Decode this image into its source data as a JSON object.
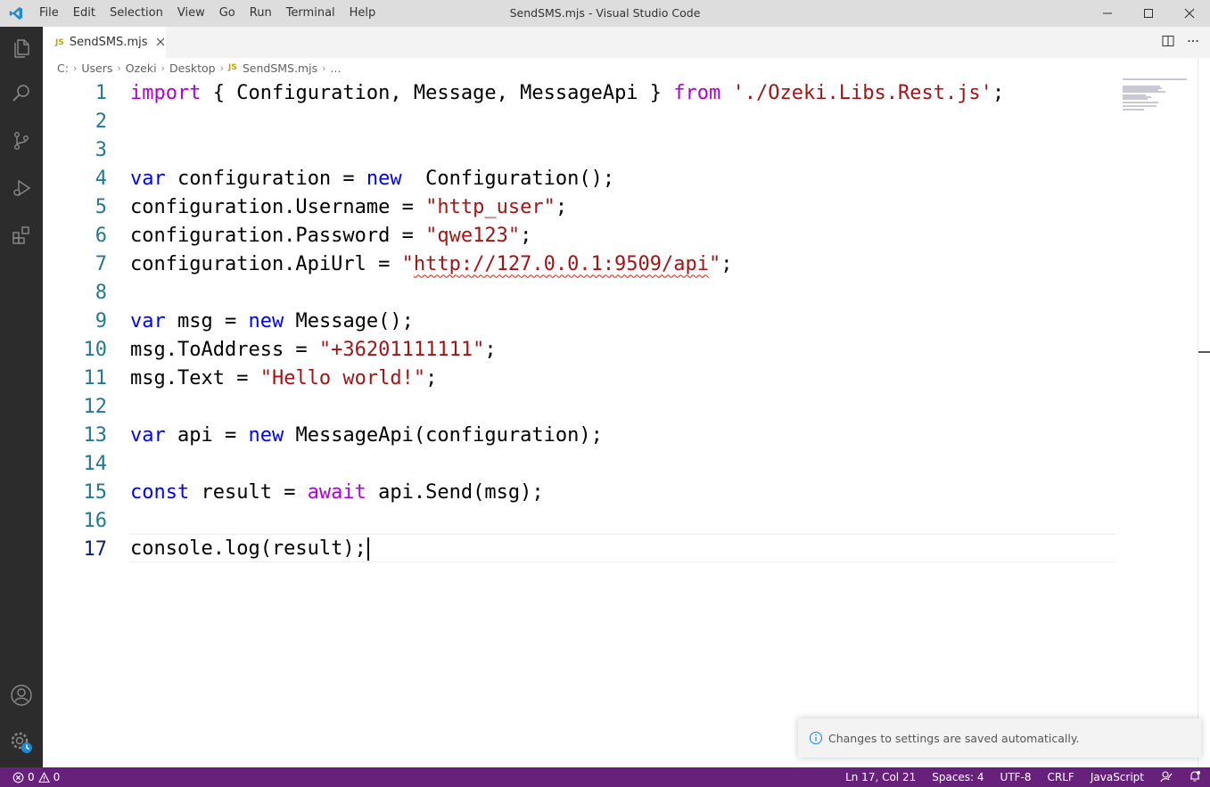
{
  "window": {
    "title": "SendSMS.mjs - Visual Studio Code"
  },
  "menu": [
    "File",
    "Edit",
    "Selection",
    "View",
    "Go",
    "Run",
    "Terminal",
    "Help"
  ],
  "tab": {
    "badge": "JS",
    "label": "SendSMS.mjs"
  },
  "breadcrumb": {
    "parts": [
      "C:",
      "Users",
      "Ozeki",
      "Desktop"
    ],
    "file_badge": "JS",
    "file": "SendSMS.mjs",
    "more": "..."
  },
  "code": {
    "line_numbers": [
      "1",
      "2",
      "3",
      "4",
      "5",
      "6",
      "7",
      "8",
      "9",
      "10",
      "11",
      "12",
      "13",
      "14",
      "15",
      "16",
      "17"
    ],
    "l1": {
      "kw1": "import",
      "t1": " { Configuration, Message, MessageApi } ",
      "kw2": "from",
      "t2": " ",
      "s1": "'./Ozeki.Libs.Rest.js'",
      "t3": ";"
    },
    "l4": {
      "kw1": "var",
      "t1": " configuration = ",
      "kw2": "new",
      "t2": "  Configuration();"
    },
    "l5": {
      "t1": "configuration.Username = ",
      "s1": "\"http_user\"",
      "t2": ";"
    },
    "l6": {
      "t1": "configuration.Password = ",
      "s1": "\"qwe123\"",
      "t2": ";"
    },
    "l7": {
      "t1": "configuration.ApiUrl = ",
      "q1": "\"",
      "s1": "http://127.0.0.1:9509/api",
      "q2": "\"",
      "t2": ";"
    },
    "l9": {
      "kw1": "var",
      "t1": " msg = ",
      "kw2": "new",
      "t2": " Message();"
    },
    "l10": {
      "t1": "msg.ToAddress = ",
      "s1": "\"+36201111111\"",
      "t2": ";"
    },
    "l11": {
      "t1": "msg.Text = ",
      "s1": "\"Hello world!\"",
      "t2": ";"
    },
    "l13": {
      "kw1": "var",
      "t1": " api = ",
      "kw2": "new",
      "t2": " MessageApi(configuration);"
    },
    "l15": {
      "kw1": "const",
      "t1": " result = ",
      "kw2": "await",
      "t2": " api.Send(msg);"
    },
    "l17": {
      "t1": "console.log(result);"
    }
  },
  "notification": {
    "text": "Changes to settings are saved automatically."
  },
  "status": {
    "errors": "0",
    "warnings": "0",
    "position": "Ln 17, Col 21",
    "spaces": "Spaces: 4",
    "encoding": "UTF-8",
    "eol": "CRLF",
    "language": "JavaScript"
  },
  "colors": {
    "status_bar": "#68217a",
    "activity_bar": "#2c2c2c",
    "keyword": "#0000ff",
    "control_keyword": "#af00db",
    "string": "#a31515",
    "line_number": "#237893"
  },
  "icons": [
    "vscode-logo-icon",
    "minimize-icon",
    "maximize-icon",
    "close-icon",
    "explorer-icon",
    "search-icon",
    "source-control-icon",
    "run-debug-icon",
    "extensions-icon",
    "accounts-icon",
    "manage-gear-icon",
    "split-editor-icon",
    "more-actions-icon",
    "info-icon",
    "error-icon",
    "warning-icon",
    "feedback-icon",
    "bell-icon"
  ]
}
